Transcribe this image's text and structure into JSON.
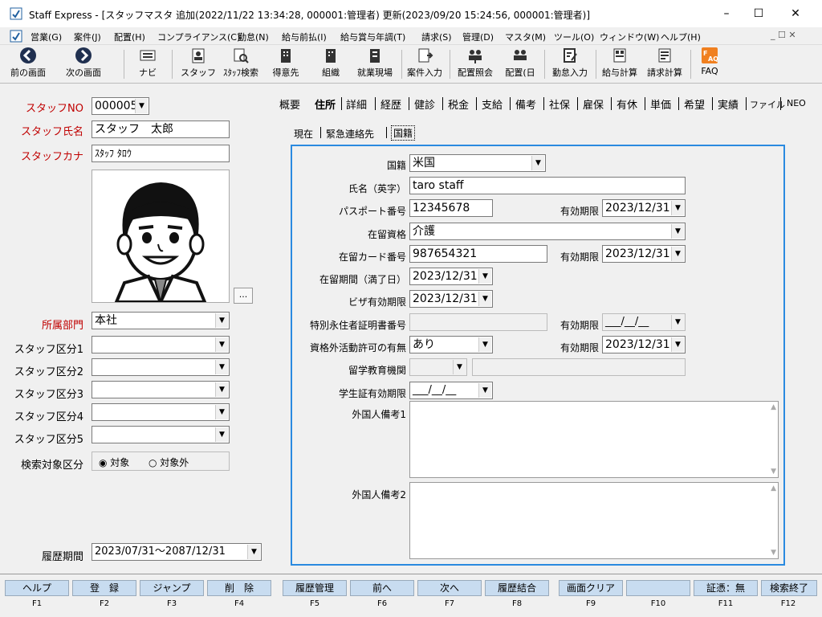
{
  "window": {
    "title": "Staff Express - [スタッフマスタ 追加(2022/11/22 13:34:28, 000001:管理者) 更新(2023/09/20 15:24:56, 000001:管理者)]",
    "minimize": "–",
    "maximize": "☐",
    "close": "✕"
  },
  "menu": [
    "営業(G)",
    "案件(J)",
    "配置(H)",
    "コンプライアンス(C)",
    "勤怠(N)",
    "給与前払(I)",
    "給与賞与年調(T)",
    "請求(S)",
    "管理(D)",
    "マスタ(M)",
    "ツール(O)",
    "ウィンドウ(W)",
    "ヘルプ(H)"
  ],
  "toolbar": [
    "前の画面",
    "次の画面",
    "ナビ",
    "スタッフ",
    "ｽﾀｯﾌ検索",
    "得意先",
    "組織",
    "就業現場",
    "案件入力",
    "配置照会",
    "配置(日",
    "勤怠入力",
    "給与計算",
    "請求計算",
    "FAQ"
  ],
  "left": {
    "staff_no_label": "スタッフNO",
    "staff_no": "000005",
    "name_label": "スタッフ氏名",
    "name": "スタッフ　太郎",
    "kana_label": "スタッフカナ",
    "kana": "ｽﾀｯﾌ ﾀﾛｳ",
    "photo_button": "...",
    "dept_label": "所属部門",
    "dept": "本社",
    "kubun_labels": [
      "スタッフ区分1",
      "スタッフ区分2",
      "スタッフ区分3",
      "スタッフ区分4",
      "スタッフ区分5"
    ],
    "search_label": "検索対象区分",
    "radio_on": "対象",
    "radio_off": "対象外",
    "history_label": "履歴期間",
    "history": "2023/07/31〜2087/12/31"
  },
  "tabs": [
    "概要",
    "住所",
    "詳細",
    "経歴",
    "健診",
    "税金",
    "支給",
    "備考",
    "社保",
    "雇保",
    "有休",
    "単価",
    "希望",
    "実績",
    "ファイル",
    "NEO"
  ],
  "subtabs": [
    "現在",
    "緊急連絡先",
    "国籍"
  ],
  "form": {
    "nationality_label": "国籍",
    "nationality": "米国",
    "name_en_label": "氏名（英字）",
    "name_en": "taro staff",
    "passport_label": "パスポート番号",
    "passport": "12345678",
    "expiry_label": "有効期限",
    "passport_expiry": "2023/12/31",
    "status_label": "在留資格",
    "status": "介護",
    "card_label": "在留カード番号",
    "card": "987654321",
    "card_expiry": "2023/12/31",
    "period_label": "在留期間（満了日）",
    "period": "2023/12/31",
    "visa_label": "ビザ有効期限",
    "visa": "2023/12/31",
    "perm_label": "特別永住者証明書番号",
    "perm": "",
    "perm_expiry": "___/__/__",
    "outside_label": "資格外活動許可の有無",
    "outside": "あり",
    "outside_expiry": "2023/12/31",
    "school_label": "留学教育機関",
    "student_label": "学生証有効期限",
    "student": "___/__/__",
    "note1_label": "外国人備考1",
    "note2_label": "外国人備考2"
  },
  "fkeys": [
    {
      "label": "ヘルプ",
      "key": "F1"
    },
    {
      "label": "登　録",
      "key": "F2"
    },
    {
      "label": "ジャンプ",
      "key": "F3"
    },
    {
      "label": "削　除",
      "key": "F4"
    },
    {
      "label": "履歴管理",
      "key": "F5"
    },
    {
      "label": "前へ",
      "key": "F6"
    },
    {
      "label": "次へ",
      "key": "F7"
    },
    {
      "label": "履歴結合",
      "key": "F8"
    },
    {
      "label": "画面クリア",
      "key": "F9"
    },
    {
      "label": "",
      "key": "F10"
    },
    {
      "label": "証憑：無",
      "key": "F11"
    },
    {
      "label": "検索終了",
      "key": "F12"
    }
  ]
}
